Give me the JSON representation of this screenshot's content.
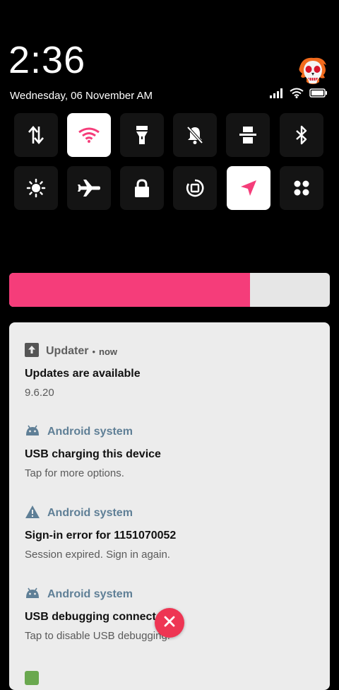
{
  "status": {
    "time": "2:36",
    "date": "Wednesday, 06 November AM",
    "icons": [
      "signal-icon",
      "wifi-icon",
      "battery-icon"
    ]
  },
  "quick_settings": [
    {
      "name": "mobile-data",
      "icon": "data-transfer-icon",
      "active": false
    },
    {
      "name": "wifi",
      "icon": "wifi-icon",
      "active": true
    },
    {
      "name": "flashlight",
      "icon": "flashlight-icon",
      "active": false
    },
    {
      "name": "silent",
      "icon": "bell-off-icon",
      "active": false
    },
    {
      "name": "screenshot",
      "icon": "screenshot-icon",
      "active": false
    },
    {
      "name": "bluetooth",
      "icon": "bluetooth-icon",
      "active": false
    },
    {
      "name": "auto-brightness",
      "icon": "brightness-icon",
      "active": false
    },
    {
      "name": "airplane-mode",
      "icon": "airplane-icon",
      "active": false
    },
    {
      "name": "lock",
      "icon": "lock-icon",
      "active": false
    },
    {
      "name": "auto-rotate",
      "icon": "rotate-icon",
      "active": false
    },
    {
      "name": "location",
      "icon": "location-icon",
      "active": true
    },
    {
      "name": "more",
      "icon": "grid-icon",
      "active": false
    }
  ],
  "brightness": {
    "level": 0.75,
    "fill_color": "#f53d7a",
    "track_color": "#e6e6e6"
  },
  "accent": "#f53d7a",
  "notifications": [
    {
      "app": "Updater",
      "time": "now",
      "title": "Updates are available",
      "text": "9.6.20",
      "icon": "update-icon"
    },
    {
      "app": "Android system",
      "title": "USB charging this device",
      "text": "Tap for more options.",
      "icon": "android-icon"
    },
    {
      "app": "Android system",
      "title": "Sign-in error for 1151070052",
      "text": "Session expired. Sign in again.",
      "icon": "warning-icon"
    },
    {
      "app": "Android system",
      "title": "USB debugging connected",
      "text": "Tap to disable USB debugging.",
      "icon": "android-icon"
    }
  ]
}
